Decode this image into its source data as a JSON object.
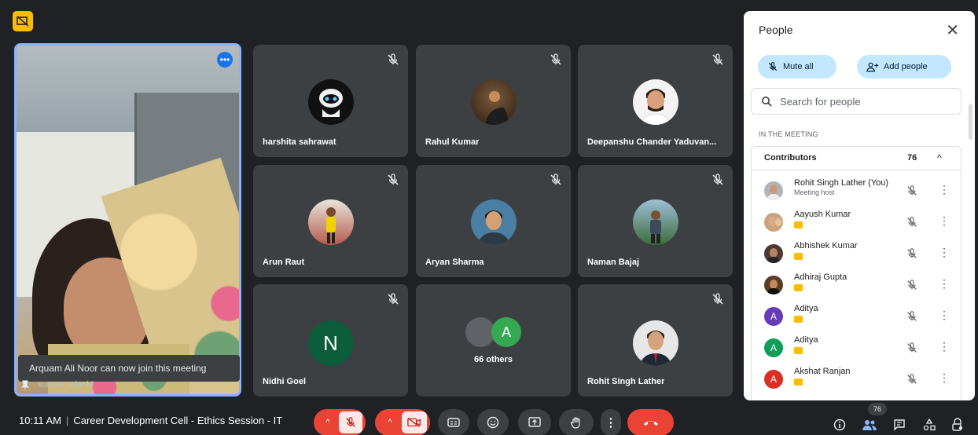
{
  "spotlight": {
    "name": "suman solanki",
    "toast": "Arquam Ali Noor can now join this meeting",
    "more_label": "•••"
  },
  "tiles": [
    {
      "name": "harshita sahrawat",
      "avatar": "robot-avatar"
    },
    {
      "name": "Rahul Kumar",
      "avatar": "photo-avatar"
    },
    {
      "name": "Deepanshu Chander Yaduvan...",
      "avatar": "photo-avatar"
    },
    {
      "name": "Arun Raut",
      "avatar": "photo-avatar"
    },
    {
      "name": "Aryan Sharma",
      "avatar": "photo-avatar"
    },
    {
      "name": "Naman Bajaj",
      "avatar": "photo-avatar"
    },
    {
      "name": "Nidhi Goel",
      "avatar": "N",
      "avatar_color": "#0b5d3b"
    },
    {
      "name": "66 others",
      "avatar": "A",
      "avatar_color": "#34a853"
    },
    {
      "name": "Rohit Singh Lather",
      "avatar": "photo-avatar"
    }
  ],
  "people_panel": {
    "title": "People",
    "close_label": "✕",
    "mute_all": "Mute all",
    "add_people": "Add people",
    "search_placeholder": "Search for people",
    "section_label": "IN THE MEETING",
    "group_label": "Contributors",
    "group_count": "76",
    "participants": [
      {
        "name": "Rohit Singh Lather (You)",
        "subtitle": "Meeting host",
        "initial": "",
        "color": "#b0b5b9"
      },
      {
        "name": "Aayush Kumar",
        "subtitle": "",
        "initial": "",
        "color": "#c9a37c"
      },
      {
        "name": "Abhishek Kumar",
        "subtitle": "",
        "initial": "",
        "color": "#4a3a33"
      },
      {
        "name": "Adhiraj Gupta",
        "subtitle": "",
        "initial": "",
        "color": "#5a3b26"
      },
      {
        "name": "Aditya",
        "subtitle": "",
        "initial": "A",
        "color": "#673ab7"
      },
      {
        "name": "Aditya",
        "subtitle": "",
        "initial": "A",
        "color": "#0f9d58"
      },
      {
        "name": "Akshat Ranjan",
        "subtitle": "",
        "initial": "A",
        "color": "#d93025"
      }
    ]
  },
  "bottom_bar": {
    "time": "10:11 AM",
    "separator": "|",
    "meeting_title": "Career Development Cell - Ethics Session - IT",
    "people_count": "76"
  }
}
